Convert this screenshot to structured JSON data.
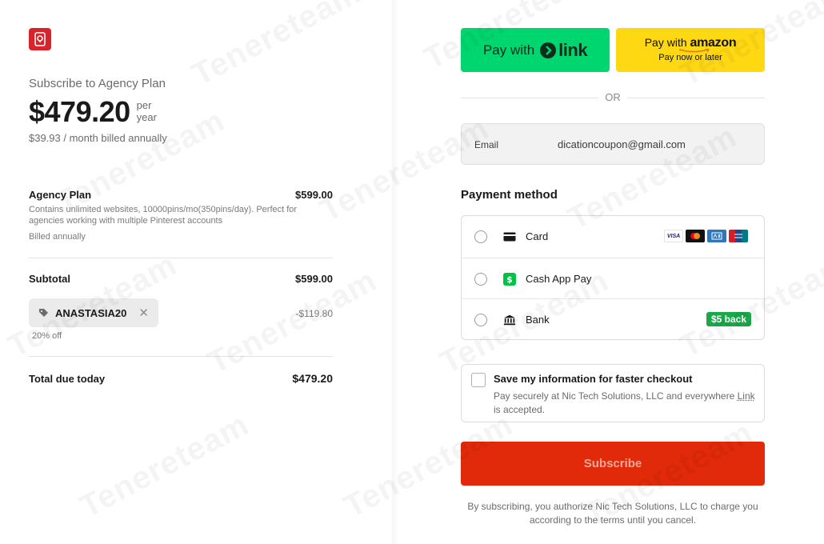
{
  "watermark": "Tenereteam",
  "summary": {
    "subscribe_to": "Subscribe to Agency Plan",
    "price": "$479.20",
    "per": "per",
    "period": "year",
    "monthly_note": "$39.93 / month billed annually",
    "item": {
      "name": "Agency Plan",
      "price": "$599.00",
      "description": "Contains unlimited websites, 10000pins/mo(350pins/day). Perfect for agencies working with multiple Pinterest accounts",
      "billing": "Billed annually"
    },
    "subtotal_label": "Subtotal",
    "subtotal_value": "$599.00",
    "coupon_code": "ANASTASIA20",
    "discount_value": "-$119.80",
    "discount_percent": "20% off",
    "total_label": "Total due today",
    "total_value": "$479.20"
  },
  "wallets": {
    "link_pay_text": "Pay with",
    "link_brand": "link",
    "amazon_pay_with": "Pay with",
    "amazon_brand": "amazon",
    "amazon_subtext": "Pay now or later"
  },
  "divider_text": "OR",
  "email": {
    "label": "Email",
    "value": "dicationcoupon@gmail.com"
  },
  "payment": {
    "title": "Payment method",
    "options": [
      {
        "label": "Card",
        "icon": "credit-card-icon"
      },
      {
        "label": "Cash App Pay",
        "icon": "cash-app-icon"
      },
      {
        "label": "Bank",
        "icon": "bank-icon",
        "badge": "$5 back"
      }
    ],
    "card_brands": [
      "VISA",
      "Mastercard",
      "AMEX",
      "UnionPay"
    ]
  },
  "save_info": {
    "title": "Save my information for faster checkout",
    "desc_prefix": "Pay securely at Nic Tech Solutions, LLC and everywhere ",
    "link_word": "Link",
    "desc_suffix": " is accepted."
  },
  "subscribe_label": "Subscribe",
  "terms": "By subscribing, you authorize Nic Tech Solutions, LLC to charge you according to the terms until you cancel.",
  "colors": {
    "link_green": "#00d66f",
    "amazon_yellow": "#ffd814",
    "subscribe_red": "#e02a0a",
    "badge_green": "#1aa84a",
    "logo_red": "#d8232a"
  }
}
